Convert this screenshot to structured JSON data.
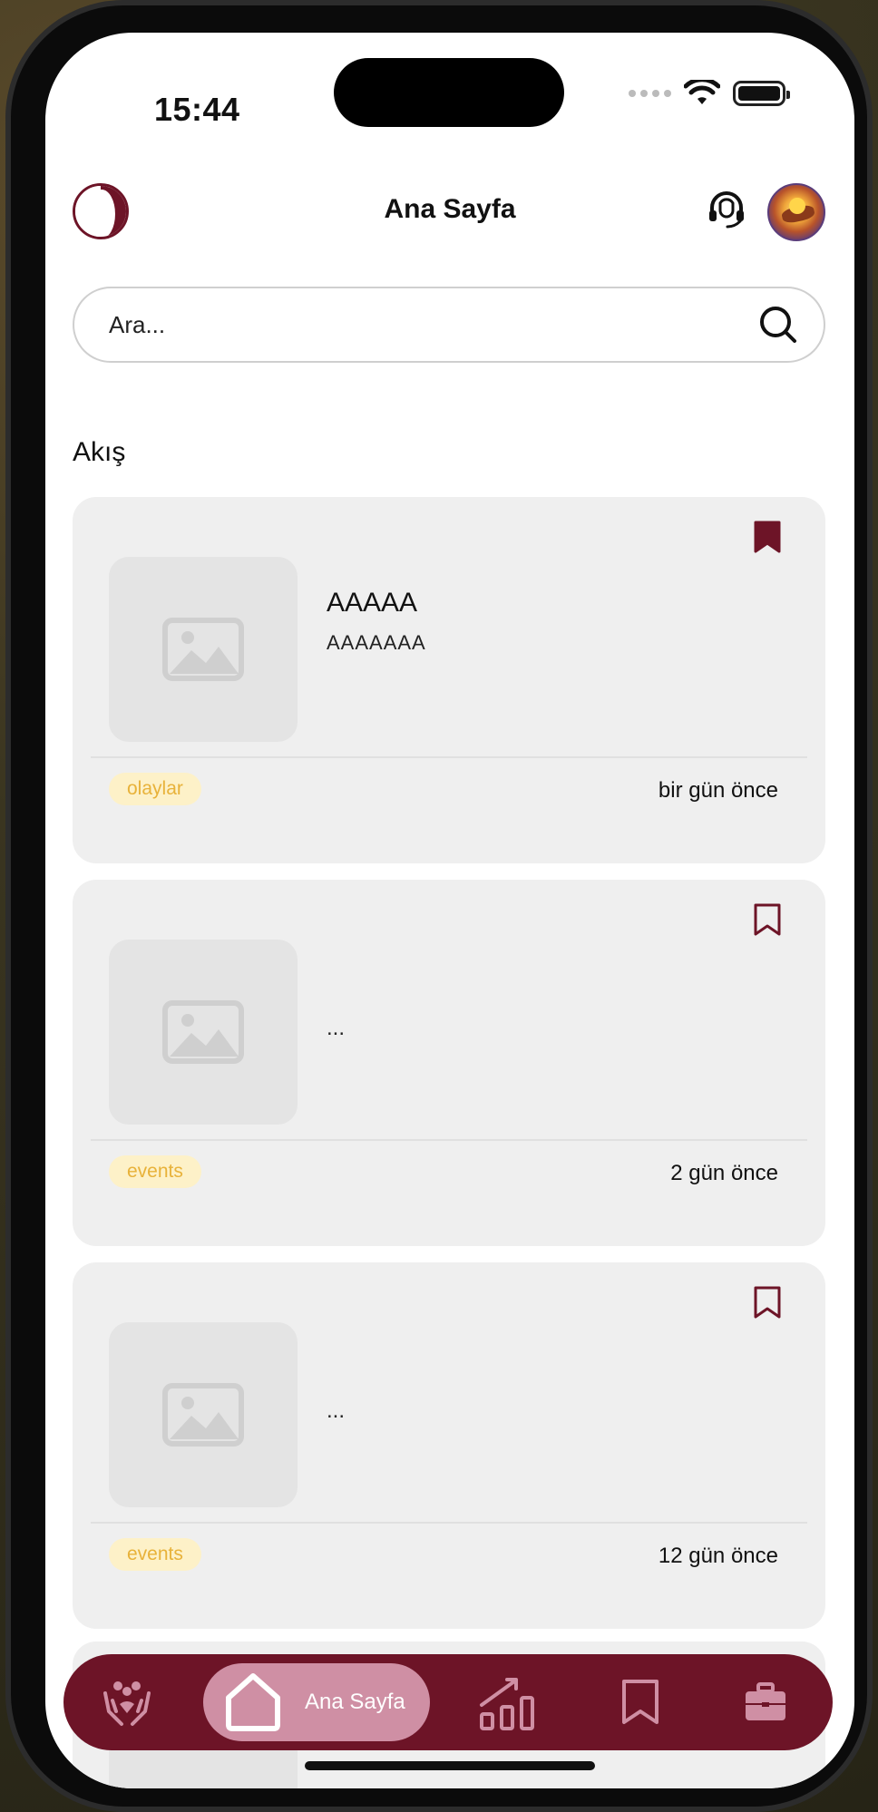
{
  "status_bar": {
    "time": "15:44"
  },
  "header": {
    "title": "Ana Sayfa"
  },
  "search": {
    "placeholder": "Ara..."
  },
  "feed": {
    "title": "Akış",
    "cards": [
      {
        "title": "AAAAA",
        "subtitle": "AAAAAAA",
        "tag": "olaylar",
        "time": "bir gün önce",
        "bookmarked": true
      },
      {
        "title": "",
        "subtitle": "...",
        "tag": "events",
        "time": "2 gün önce",
        "bookmarked": false
      },
      {
        "title": "",
        "subtitle": "...",
        "tag": "events",
        "time": "12 gün önce",
        "bookmarked": false
      }
    ]
  },
  "bottom_nav": {
    "items": [
      {
        "icon": "community-icon"
      },
      {
        "icon": "home-icon",
        "label": "Ana Sayfa",
        "active": true
      },
      {
        "icon": "chart-icon"
      },
      {
        "icon": "bookmark-icon"
      },
      {
        "icon": "briefcase-icon"
      }
    ]
  },
  "colors": {
    "brand": "#6d1427",
    "nav_active": "#cf8fa4",
    "tag_bg": "#fdf1c8",
    "tag_text": "#e8b23a",
    "card_bg": "#efefef"
  }
}
